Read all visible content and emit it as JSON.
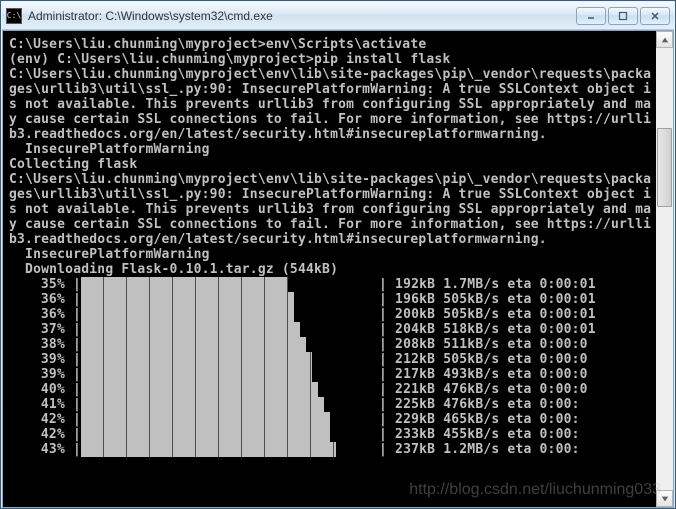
{
  "window": {
    "icon_text": "C:\\",
    "title": "Administrator: C:\\Windows\\system32\\cmd.exe",
    "buttons": {
      "min": "minimize",
      "max": "maximize",
      "close": "close"
    }
  },
  "scrollbar": {
    "thumb_top_pct": 18,
    "thumb_height_pct": 18
  },
  "lines": [
    "",
    "C:\\Users\\liu.chunming\\myproject>env\\Scripts\\activate",
    "(env) C:\\Users\\liu.chunming\\myproject>pip install flask",
    "C:\\Users\\liu.chunming\\myproject\\env\\lib\\site-packages\\pip\\_vendor\\requests\\packa",
    "ges\\urllib3\\util\\ssl_.py:90: InsecurePlatformWarning: A true SSLContext object i",
    "s not available. This prevents urllib3 from configuring SSL appropriately and ma",
    "y cause certain SSL connections to fail. For more information, see https://urlli",
    "b3.readthedocs.org/en/latest/security.html#insecureplatformwarning.",
    "  InsecurePlatformWarning",
    "Collecting flask",
    "C:\\Users\\liu.chunming\\myproject\\env\\lib\\site-packages\\pip\\_vendor\\requests\\packa",
    "ges\\urllib3\\util\\ssl_.py:90: InsecurePlatformWarning: A true SSLContext object i",
    "s not available. This prevents urllib3 from configuring SSL appropriately and ma",
    "y cause certain SSL connections to fail. For more information, see https://urlli",
    "b3.readthedocs.org/en/latest/security.html#insecureplatformwarning.",
    "  InsecurePlatformWarning",
    "  Downloading Flask-0.10.1.tar.gz (544kB)"
  ],
  "progress": [
    {
      "pct": "35%",
      "fill_pct": 35,
      "stat": "| 192kB 1.7MB/s eta 0:00:01"
    },
    {
      "pct": "36%",
      "fill_pct": 36,
      "stat": "| 196kB 505kB/s eta 0:00:01"
    },
    {
      "pct": "36%",
      "fill_pct": 36,
      "stat": "| 200kB 505kB/s eta 0:00:01"
    },
    {
      "pct": "37%",
      "fill_pct": 37,
      "stat": "| 204kB 518kB/s eta 0:00:01"
    },
    {
      "pct": "38%",
      "fill_pct": 38,
      "stat": "| 208kB 511kB/s eta 0:00:0"
    },
    {
      "pct": "39%",
      "fill_pct": 39,
      "stat": "| 212kB 505kB/s eta 0:00:0"
    },
    {
      "pct": "39%",
      "fill_pct": 39,
      "stat": "| 217kB 493kB/s eta 0:00:0"
    },
    {
      "pct": "40%",
      "fill_pct": 40,
      "stat": "| 221kB 476kB/s eta 0:00:0"
    },
    {
      "pct": "41%",
      "fill_pct": 41,
      "stat": "| 225kB 476kB/s eta 0:00:"
    },
    {
      "pct": "42%",
      "fill_pct": 42,
      "stat": "| 229kB 465kB/s eta 0:00:"
    },
    {
      "pct": "42%",
      "fill_pct": 42,
      "stat": "| 233kB 455kB/s eta 0:00:"
    },
    {
      "pct": "43%",
      "fill_pct": 43,
      "stat": "| 237kB 1.2MB/s eta 0:00:"
    }
  ],
  "watermark": "http://blog.csdn.net/liuchunming033"
}
